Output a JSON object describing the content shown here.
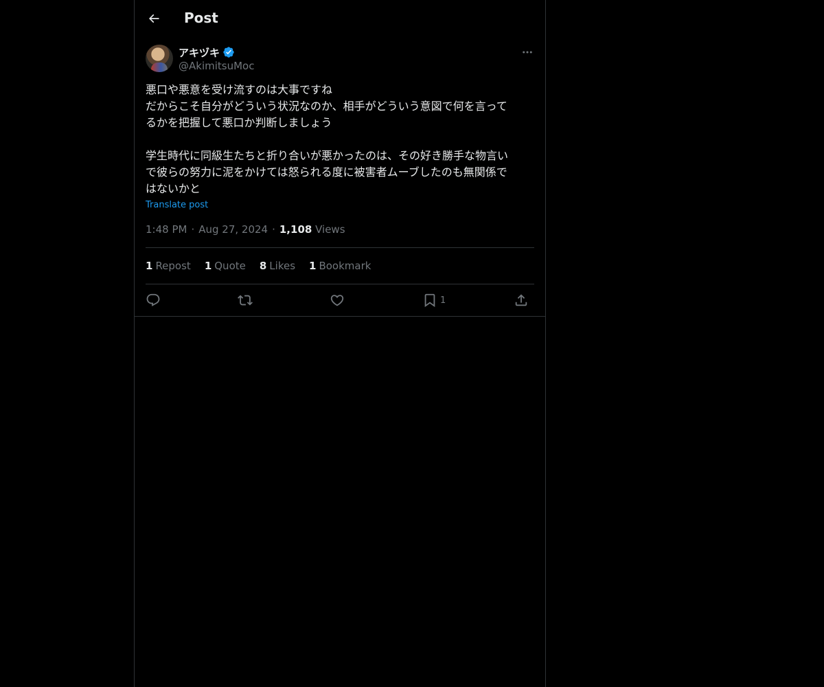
{
  "header": {
    "title": "Post",
    "back_icon": "arrow-left-icon"
  },
  "tweet": {
    "author": {
      "display_name": "アキヅキ",
      "handle": "@AkimitsuMoc",
      "verified": true
    },
    "text_lines": [
      "悪口や悪意を受け流すのは大事ですね",
      "だからこそ自分がどういう状況なのか、相手がどういう意図で何を言って",
      "るかを把握して悪口か判断しましょう",
      "",
      "学生時代に同級生たちと折り合いが悪かったのは、その好き勝手な物言い",
      "で彼らの努力に泥をかけては怒られる度に被害者ムーブしたのも無関係で",
      "はないかと"
    ],
    "translate_label": "Translate post",
    "time": "1:48 PM",
    "separator": "·",
    "date": "Aug 27, 2024",
    "views_count": "1,108",
    "views_label": "Views",
    "stats": {
      "reposts": {
        "count": "1",
        "label": "Repost"
      },
      "quotes": {
        "count": "1",
        "label": "Quote"
      },
      "likes": {
        "count": "8",
        "label": "Likes"
      },
      "bookmarks": {
        "count": "1",
        "label": "Bookmark"
      }
    },
    "actions": {
      "bookmark_count": "1"
    }
  },
  "colors": {
    "background": "#000000",
    "text": "#e7e9ea",
    "secondary": "#71767b",
    "accent": "#1d9bf0",
    "border": "#2f3336"
  }
}
